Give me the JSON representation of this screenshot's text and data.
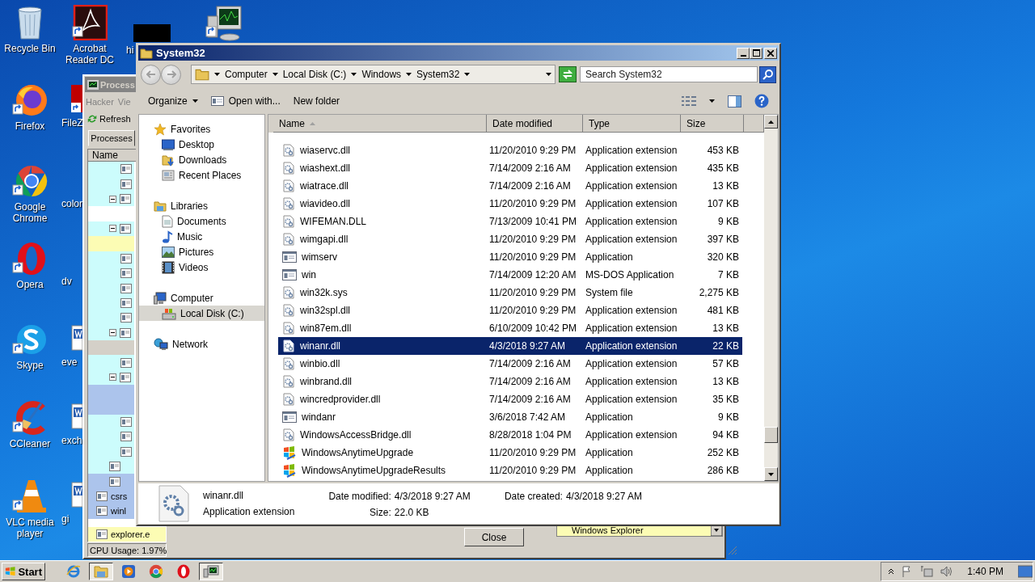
{
  "desktop_columns": [
    [
      {
        "label": "Recycle Bin",
        "kind": "recycle"
      },
      {
        "label": "Firefox",
        "kind": "firefox"
      },
      {
        "label": "Google Chrome",
        "kind": "chrome"
      },
      {
        "label": "Opera",
        "kind": "opera"
      },
      {
        "label": "Skype",
        "kind": "skype"
      },
      {
        "label": "CCleaner",
        "kind": "ccleaner"
      },
      {
        "label": "VLC media player",
        "kind": "vlc"
      }
    ],
    [
      {
        "label": "Acrobat Reader DC",
        "kind": "acrobat"
      },
      {
        "label": "FileZ",
        "kind": "filezilla"
      },
      {
        "label": "color",
        "kind": "plain"
      },
      {
        "label": "dv",
        "kind": "plain"
      },
      {
        "label": "eve",
        "kind": "doc"
      },
      {
        "label": "exch",
        "kind": "doc"
      },
      {
        "label": "gi",
        "kind": "doc"
      }
    ],
    [
      {
        "label": "hi",
        "kind": "blackbox"
      }
    ],
    [
      {
        "kind": "monitor"
      }
    ]
  ],
  "process_window": {
    "title": "Process",
    "menu": [
      "Hacker",
      "Vie"
    ],
    "toolbar": "Refresh",
    "tab": "Processes",
    "column": "Name",
    "rows": [
      {
        "kind": "item",
        "color": "#ccfcfc"
      },
      {
        "kind": "item",
        "color": "#ccfcfc"
      },
      {
        "kind": "group",
        "color": "#ccfcfc"
      },
      {
        "kind": "blank"
      },
      {
        "kind": "group",
        "color": "#ccfcfc"
      },
      {
        "kind": "empty",
        "color": "#fcfcb4"
      },
      {
        "kind": "item",
        "color": "#ccfcfc"
      },
      {
        "kind": "item",
        "color": "#ccfcfc"
      },
      {
        "kind": "item",
        "color": "#ccfcfc"
      },
      {
        "kind": "item",
        "color": "#ccfcfc"
      },
      {
        "kind": "item",
        "color": "#ccfcfc"
      },
      {
        "kind": "group",
        "color": "#ccfcfc"
      },
      {
        "kind": "empty",
        "color": "#d4d0c8"
      },
      {
        "kind": "item",
        "color": "#ccfcfc"
      },
      {
        "kind": "group",
        "color": "#ccfcfc"
      },
      {
        "kind": "empty",
        "color": "#acc4ec"
      },
      {
        "kind": "empty",
        "color": "#acc4ec"
      },
      {
        "kind": "item",
        "color": "#ccfcfc"
      },
      {
        "kind": "item",
        "color": "#ccfcfc"
      },
      {
        "kind": "item",
        "color": "#ccfcfc"
      },
      {
        "kind": "app",
        "color": "#ccfcfc"
      },
      {
        "kind": "app",
        "color": "#acc4ec"
      },
      {
        "kind": "named",
        "color": "#acc4ec",
        "name": "csrs"
      },
      {
        "kind": "named",
        "color": "#acc4ec",
        "name": "winl"
      },
      {
        "kind": "named",
        "color": "#fcfcb4",
        "name": "explorer.e"
      }
    ],
    "status": "CPU Usage: 1.97%",
    "close_button": "Close",
    "combo": "Windows Explorer"
  },
  "explorer": {
    "title": "System32",
    "breadcrumb": [
      "Computer",
      "Local Disk (C:)",
      "Windows",
      "System32"
    ],
    "search": {
      "placeholder": "Search System32"
    },
    "commands": [
      {
        "label": "Organize",
        "kind": "menu"
      },
      {
        "label": "Open with...",
        "kind": "open"
      },
      {
        "label": "New folder",
        "kind": "plain"
      }
    ],
    "nav": [
      {
        "label": "Favorites",
        "kind": "star",
        "selected": false,
        "children": [
          {
            "label": "Desktop",
            "kind": "desktop",
            "selected": false
          },
          {
            "label": "Downloads",
            "kind": "downloads",
            "selected": false
          },
          {
            "label": "Recent Places",
            "kind": "recent",
            "selected": false
          }
        ]
      },
      {
        "label": "Libraries",
        "kind": "libraries",
        "selected": false,
        "children": [
          {
            "label": "Documents",
            "kind": "documents",
            "selected": false
          },
          {
            "label": "Music",
            "kind": "music",
            "selected": false
          },
          {
            "label": "Pictures",
            "kind": "pictures",
            "selected": false
          },
          {
            "label": "Videos",
            "kind": "videos",
            "selected": false
          }
        ]
      },
      {
        "label": "Computer",
        "kind": "computer",
        "selected": false,
        "children": [
          {
            "label": "Local Disk (C:)",
            "kind": "disk",
            "selected": true
          }
        ]
      },
      {
        "label": "Network",
        "kind": "network",
        "selected": false
      }
    ],
    "columns": [
      {
        "label": "Name",
        "sorted": true
      },
      {
        "label": "Date modified",
        "sorted": false
      },
      {
        "label": "Type",
        "sorted": false
      },
      {
        "label": "Size",
        "sorted": false
      }
    ],
    "files": [
      {
        "name": "wiaservc.dll",
        "date": "11/20/2010 9:29 PM",
        "type": "Application extension",
        "size": "453 KB",
        "kind": "dll",
        "selected": false
      },
      {
        "name": "wiashext.dll",
        "date": "7/14/2009 2:16 AM",
        "type": "Application extension",
        "size": "435 KB",
        "kind": "dll",
        "selected": false
      },
      {
        "name": "wiatrace.dll",
        "date": "7/14/2009 2:16 AM",
        "type": "Application extension",
        "size": "13 KB",
        "kind": "dll",
        "selected": false
      },
      {
        "name": "wiavideo.dll",
        "date": "11/20/2010 9:29 PM",
        "type": "Application extension",
        "size": "107 KB",
        "kind": "dll",
        "selected": false
      },
      {
        "name": "WIFEMAN.DLL",
        "date": "7/13/2009 10:41 PM",
        "type": "Application extension",
        "size": "9 KB",
        "kind": "dll",
        "selected": false
      },
      {
        "name": "wimgapi.dll",
        "date": "11/20/2010 9:29 PM",
        "type": "Application extension",
        "size": "397 KB",
        "kind": "dll",
        "selected": false
      },
      {
        "name": "wimserv",
        "date": "11/20/2010 9:29 PM",
        "type": "Application",
        "size": "320 KB",
        "kind": "app",
        "selected": false
      },
      {
        "name": "win",
        "date": "7/14/2009 12:20 AM",
        "type": "MS-DOS Application",
        "size": "7 KB",
        "kind": "app",
        "selected": false
      },
      {
        "name": "win32k.sys",
        "date": "11/20/2010 9:29 PM",
        "type": "System file",
        "size": "2,275 KB",
        "kind": "dll",
        "selected": false
      },
      {
        "name": "win32spl.dll",
        "date": "11/20/2010 9:29 PM",
        "type": "Application extension",
        "size": "481 KB",
        "kind": "dll",
        "selected": false
      },
      {
        "name": "win87em.dll",
        "date": "6/10/2009 10:42 PM",
        "type": "Application extension",
        "size": "13 KB",
        "kind": "dll",
        "selected": false
      },
      {
        "name": "winanr.dll",
        "date": "4/3/2018 9:27 AM",
        "type": "Application extension",
        "size": "22 KB",
        "kind": "dll",
        "selected": true
      },
      {
        "name": "winbio.dll",
        "date": "7/14/2009 2:16 AM",
        "type": "Application extension",
        "size": "57 KB",
        "kind": "dll",
        "selected": false
      },
      {
        "name": "winbrand.dll",
        "date": "7/14/2009 2:16 AM",
        "type": "Application extension",
        "size": "13 KB",
        "kind": "dll",
        "selected": false
      },
      {
        "name": "wincredprovider.dll",
        "date": "7/14/2009 2:16 AM",
        "type": "Application extension",
        "size": "35 KB",
        "kind": "dll",
        "selected": false
      },
      {
        "name": "windanr",
        "date": "3/6/2018 7:42 AM",
        "type": "Application",
        "size": "9 KB",
        "kind": "app",
        "selected": false
      },
      {
        "name": "WindowsAccessBridge.dll",
        "date": "8/28/2018 1:04 PM",
        "type": "Application extension",
        "size": "94 KB",
        "kind": "dll",
        "selected": false
      },
      {
        "name": "WindowsAnytimeUpgrade",
        "date": "11/20/2010 9:29 PM",
        "type": "Application",
        "size": "252 KB",
        "kind": "upgrade",
        "selected": false
      },
      {
        "name": "WindowsAnytimeUpgradeResults",
        "date": "11/20/2010 9:29 PM",
        "type": "Application",
        "size": "286 KB",
        "kind": "upgrade",
        "selected": false
      }
    ],
    "details": {
      "name": "winanr.dll",
      "type": "Application extension",
      "fields": [
        {
          "label": "Date modified:",
          "value": "4/3/2018 9:27 AM"
        },
        {
          "label": "Size:",
          "value": "22.0 KB"
        },
        {
          "label": "Date created:",
          "value": "4/3/2018 9:27 AM"
        }
      ]
    }
  },
  "taskbar": {
    "start": "Start",
    "quick_launch": [
      {
        "kind": "ie",
        "active": false
      },
      {
        "kind": "explorer",
        "active": true
      },
      {
        "kind": "media",
        "active": false
      },
      {
        "kind": "chrome",
        "active": false
      },
      {
        "kind": "opera",
        "active": false
      },
      {
        "kind": "processhacker",
        "active": true
      }
    ],
    "clock": "1:40 PM"
  }
}
